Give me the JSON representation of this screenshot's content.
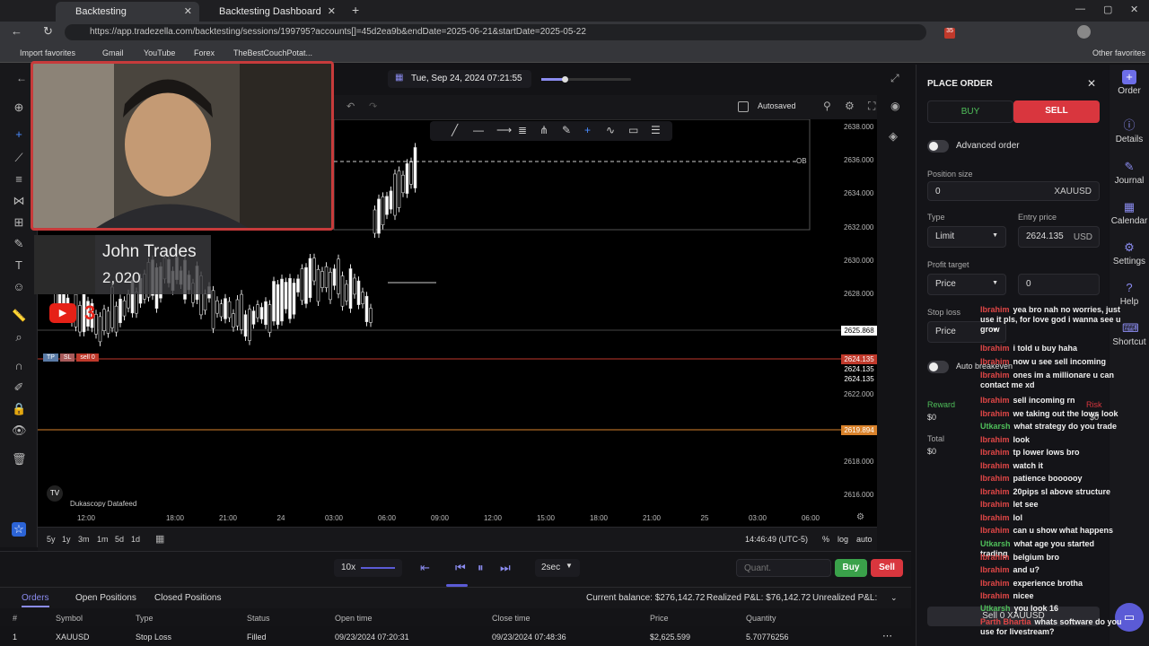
{
  "browser": {
    "tabs": [
      {
        "label": "Backtesting"
      },
      {
        "label": "Backtesting Dashboard"
      }
    ],
    "url": "https://app.tradezella.com/backtesting/sessions/199795?accounts[]=45d2ea9b&endDate=2025-06-21&startDate=2025-05-22",
    "bookmarks": [
      "Import favorites",
      "Gmail",
      "YouTube",
      "Forex",
      "TheBestCouchPotat...",
      "Other favorites"
    ],
    "badge": "35"
  },
  "session": {
    "datetime": "Tue, Sep 24, 2024 07:21:55",
    "autosave": "Autosaved"
  },
  "overlay": {
    "name": "John Trades",
    "count": "2,020",
    "yt_number": "3"
  },
  "chart": {
    "source": "Dukascopy Datafeed",
    "ob_label": "OB",
    "y_ticks": [
      "2638.000",
      "2636.000",
      "2634.000",
      "2632.000",
      "2630.000",
      "2628.000",
      "2622.000",
      "2618.000",
      "2616.000"
    ],
    "x_ticks": [
      "12:00",
      "18:00",
      "21:00",
      "24",
      "03:00",
      "06:00",
      "09:00",
      "12:00",
      "15:00",
      "18:00",
      "21:00",
      "25",
      "03:00",
      "06:00"
    ],
    "price_labels": [
      "2625.868",
      "2624.135",
      "2624.135",
      "2624.135",
      "2619.894"
    ],
    "order_tag": {
      "tp": "TP",
      "sl": "SL",
      "label": "sell 0"
    },
    "timezone": "14:46:49 (UTC-5)",
    "ranges": [
      "5y",
      "1y",
      "3m",
      "1m",
      "5d",
      "1d"
    ],
    "scale_opts": [
      "%",
      "log",
      "auto"
    ]
  },
  "playback": {
    "speed": "10x",
    "interval": "2sec",
    "quant_placeholder": "Quant.",
    "buy": "Buy",
    "sell": "Sell"
  },
  "orders": {
    "tabs": [
      "Orders",
      "Open Positions",
      "Closed Positions"
    ],
    "balance": "Current balance: $276,142.72",
    "realized": "Realized P&L: $76,142.72",
    "unrealized": "Unrealized P&L:",
    "columns": [
      "#",
      "Symbol",
      "Type",
      "Status",
      "Open time",
      "Close time",
      "Price",
      "Quantity"
    ],
    "row": [
      "1",
      "XAUUSD",
      "Stop Loss",
      "Filled",
      "09/23/2024 07:20:31",
      "09/23/2024 07:48:36",
      "$2,625.599",
      "5.70776256"
    ]
  },
  "panel": {
    "title": "PLACE ORDER",
    "buy": "BUY",
    "sell": "SELL",
    "advanced": "Advanced order",
    "position_size_label": "Position size",
    "position_size": "0",
    "symbol": "XAUUSD",
    "type_label": "Type",
    "type": "Limit",
    "entry_label": "Entry price",
    "entry": "2624.135",
    "currency": "USD",
    "profit_label": "Profit target",
    "profit_mode": "Price",
    "profit_value": "0",
    "stop_label": "Stop loss",
    "stop_mode": "Price",
    "auto_breakeven": "Auto breakeven",
    "reward_label": "Reward",
    "reward": "$0",
    "risk_label": "Risk",
    "risk": "$0",
    "total_label": "Total",
    "total": "$0",
    "submit": "Sell 0 XAUUSD"
  },
  "nav": [
    "Order",
    "Details",
    "Journal",
    "Calendar",
    "Settings",
    "Help",
    "Shortcut"
  ],
  "chat": [
    {
      "u": "Ibrahim",
      "t": "yea bro nah no worries, just use it pls, for love god i wanna see u grow",
      "g": false
    },
    {
      "u": "Ibrahim",
      "t": "i told u buy haha",
      "g": false
    },
    {
      "u": "Ibrahim",
      "t": "now u see sell incoming",
      "g": false
    },
    {
      "u": "Ibrahim",
      "t": "ones im a millionare u can contact me xd",
      "g": false
    },
    {
      "u": "Ibrahim",
      "t": "sell incoming rn",
      "g": false
    },
    {
      "u": "Ibrahim",
      "t": "we taking out the lows look",
      "g": false
    },
    {
      "u": "Utkarsh",
      "t": "what strategy do you trade",
      "g": true
    },
    {
      "u": "Ibrahim",
      "t": "look",
      "g": false
    },
    {
      "u": "Ibrahim",
      "t": "tp lower lows bro",
      "g": false
    },
    {
      "u": "Ibrahim",
      "t": "watch it",
      "g": false
    },
    {
      "u": "Ibrahim",
      "t": "patience boooooy",
      "g": false
    },
    {
      "u": "Ibrahim",
      "t": "20pips sl above structure",
      "g": false
    },
    {
      "u": "Ibrahim",
      "t": "let see",
      "g": false
    },
    {
      "u": "Ibrahim",
      "t": "lol",
      "g": false
    },
    {
      "u": "Ibrahim",
      "t": "can u show what happens",
      "g": false
    },
    {
      "u": "Utkarsh",
      "t": "what age you started trading",
      "g": true
    },
    {
      "u": "Ibrahim",
      "t": "belgium bro",
      "g": false
    },
    {
      "u": "Ibrahim",
      "t": "and u?",
      "g": false
    },
    {
      "u": "Ibrahim",
      "t": "experience brotha",
      "g": false
    },
    {
      "u": "Ibrahim",
      "t": "nicee",
      "g": false
    },
    {
      "u": "Utkarsh",
      "t": "you look 16",
      "g": true
    },
    {
      "u": "Parth Bhartia",
      "t": "whats software do you use for livestream?",
      "g": false
    }
  ],
  "colors": {
    "sell": "#d9363e",
    "buy": "#3aa14a",
    "accent": "#6d6ee8"
  }
}
